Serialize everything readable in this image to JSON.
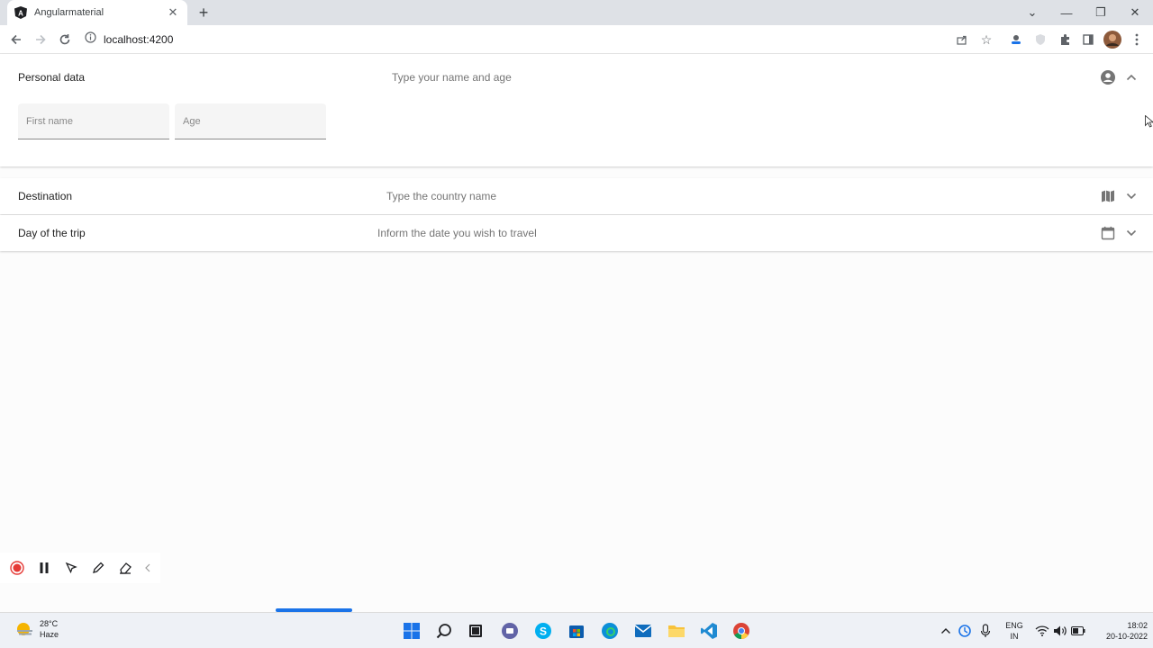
{
  "browser": {
    "tab_title": "Angularmaterial",
    "url": "localhost:4200"
  },
  "panels": [
    {
      "title": "Personal data",
      "description": "Type your name and age",
      "icon": "account-circle-icon",
      "expanded": true,
      "fields": [
        {
          "placeholder": "First name"
        },
        {
          "placeholder": "Age"
        }
      ]
    },
    {
      "title": "Destination",
      "description": "Type the country name",
      "icon": "map-icon",
      "expanded": false
    },
    {
      "title": "Day of the trip",
      "description": "Inform the date you wish to travel",
      "icon": "calendar-icon",
      "expanded": false
    }
  ],
  "taskbar": {
    "weather_temp": "28°C",
    "weather_desc": "Haze",
    "lang_line1": "ENG",
    "lang_line2": "IN",
    "time": "18:02",
    "date": "20-10-2022"
  },
  "colors": {
    "accent": "#1a73e8",
    "record": "#e53935"
  }
}
